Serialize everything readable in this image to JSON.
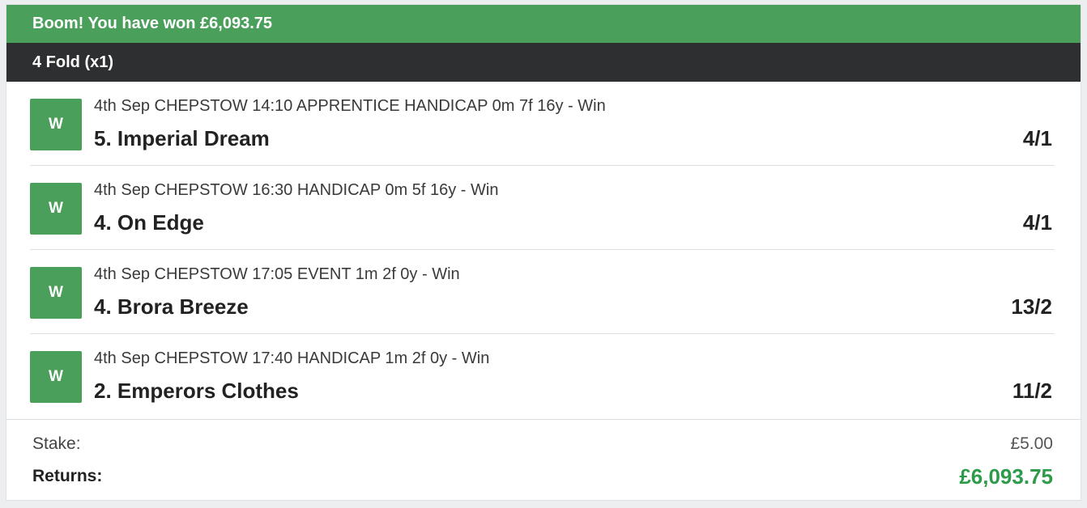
{
  "banner": {
    "text": "Boom! You have won £6,093.75"
  },
  "bet": {
    "type_label": "4 Fold (x1)"
  },
  "legs": [
    {
      "status": "W",
      "description": "4th Sep CHEPSTOW 14:10 APPRENTICE HANDICAP 0m 7f 16y - Win",
      "runner": "5. Imperial Dream",
      "odds": "4/1"
    },
    {
      "status": "W",
      "description": "4th Sep CHEPSTOW 16:30 HANDICAP 0m 5f 16y - Win",
      "runner": "4. On Edge",
      "odds": "4/1"
    },
    {
      "status": "W",
      "description": "4th Sep CHEPSTOW 17:05 EVENT 1m 2f 0y - Win",
      "runner": "4. Brora Breeze",
      "odds": "13/2"
    },
    {
      "status": "W",
      "description": "4th Sep CHEPSTOW 17:40 HANDICAP 1m 2f 0y - Win",
      "runner": "2. Emperors Clothes",
      "odds": "11/2"
    }
  ],
  "footer": {
    "stake_label": "Stake:",
    "stake_value": "£5.00",
    "returns_label": "Returns:",
    "returns_value": "£6,093.75"
  },
  "colors": {
    "win_green": "#4a9f5b",
    "dark_bar": "#2e2f31",
    "returns_green": "#2d9b4a"
  }
}
